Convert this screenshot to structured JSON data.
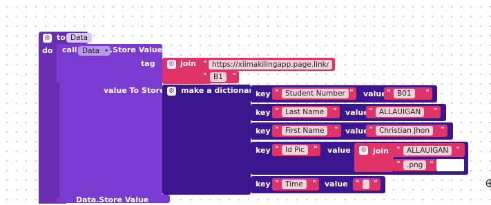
{
  "procedure": {
    "to_label": "to",
    "name": "Data",
    "do_label": "do"
  },
  "call": {
    "call_label": "call",
    "component": "Data",
    "method": ".Store Value",
    "tag_label": "tag",
    "value_label": "value To Store"
  },
  "join1": {
    "label": "join",
    "parts": [
      "https://xiimakilingapp.page.link/",
      "B1"
    ]
  },
  "dict": {
    "label": "make a dictionary",
    "key_label": "key",
    "value_label": "value",
    "entries": [
      {
        "key": "Student Number",
        "value": "B01"
      },
      {
        "key": "Last Name",
        "value": "ALLAUIGAN"
      },
      {
        "key": "First Name",
        "value": "Christian Jhon"
      },
      {
        "key": "Id Pic",
        "join_label": "join",
        "join_parts": [
          "ALLAUIGAN",
          ".png"
        ]
      },
      {
        "key": "Time",
        "value": ""
      }
    ]
  },
  "bottom_partial": "Data.Store Value",
  "colors": {
    "procedure": "#6a2fb0",
    "call": "#7c3bd0",
    "text": "#e03468",
    "dictionary": "#3a178e",
    "grid_dot": "#c8c8c8"
  }
}
